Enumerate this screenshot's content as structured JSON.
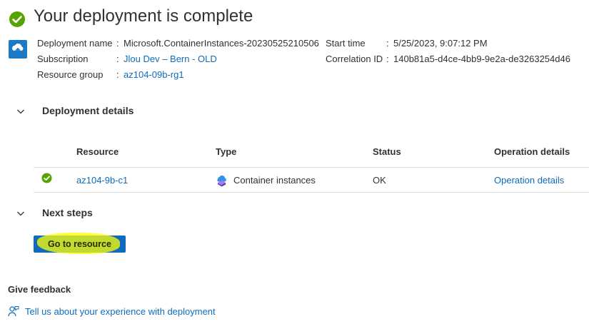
{
  "header": {
    "title": "Your deployment is complete"
  },
  "summary": {
    "deployment_name_label": "Deployment name",
    "deployment_name_value": "Microsoft.ContainerInstances-20230525210506",
    "subscription_label": "Subscription",
    "subscription_value": "Jlou Dev – Bern - OLD",
    "resource_group_label": "Resource group",
    "resource_group_value": "az104-09b-rg1",
    "start_time_label": "Start time",
    "start_time_value": "5/25/2023, 9:07:12 PM",
    "correlation_id_label": "Correlation ID",
    "correlation_id_value": "140b81a5-d4ce-4bb9-9e2a-de3263254d46",
    "colon": ":"
  },
  "deployment_details": {
    "heading": "Deployment details",
    "columns": {
      "resource": "Resource",
      "type": "Type",
      "status": "Status",
      "operation_details": "Operation details"
    },
    "rows": [
      {
        "resource": "az104-9b-c1",
        "type": "Container instances",
        "status": "OK",
        "operation_details": "Operation details"
      }
    ]
  },
  "next_steps": {
    "heading": "Next steps",
    "button_label": "Go to resource"
  },
  "feedback": {
    "heading": "Give feedback",
    "link": "Tell us about your experience with deployment"
  },
  "colors": {
    "success": "#57a300",
    "link": "#0f6cbd",
    "primary_button": "#0f6cbd",
    "annotation_highlight": "#ffff00"
  },
  "icons": {
    "status": "success-check-icon",
    "deployment": "deployment-cloud-icon",
    "resource_type": "container-instances-icon",
    "feedback": "feedback-person-icon",
    "section_toggle": "chevron-down-icon"
  }
}
